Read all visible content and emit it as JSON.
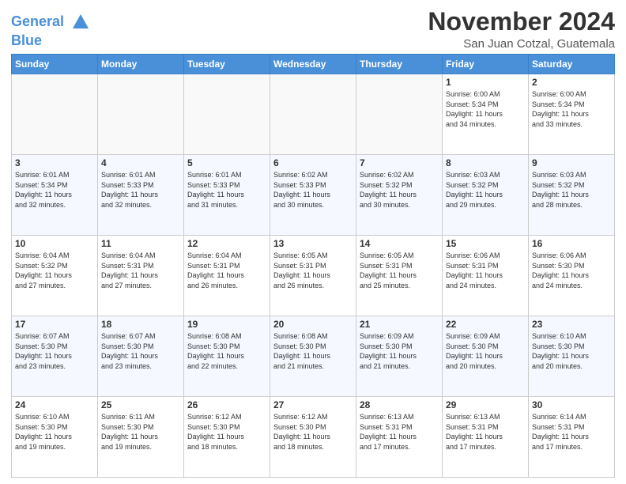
{
  "logo": {
    "line1": "General",
    "line2": "Blue"
  },
  "title": "November 2024",
  "location": "San Juan Cotzal, Guatemala",
  "days_header": [
    "Sunday",
    "Monday",
    "Tuesday",
    "Wednesday",
    "Thursday",
    "Friday",
    "Saturday"
  ],
  "weeks": [
    [
      {
        "day": "",
        "info": ""
      },
      {
        "day": "",
        "info": ""
      },
      {
        "day": "",
        "info": ""
      },
      {
        "day": "",
        "info": ""
      },
      {
        "day": "",
        "info": ""
      },
      {
        "day": "1",
        "info": "Sunrise: 6:00 AM\nSunset: 5:34 PM\nDaylight: 11 hours\nand 34 minutes."
      },
      {
        "day": "2",
        "info": "Sunrise: 6:00 AM\nSunset: 5:34 PM\nDaylight: 11 hours\nand 33 minutes."
      }
    ],
    [
      {
        "day": "3",
        "info": "Sunrise: 6:01 AM\nSunset: 5:34 PM\nDaylight: 11 hours\nand 32 minutes."
      },
      {
        "day": "4",
        "info": "Sunrise: 6:01 AM\nSunset: 5:33 PM\nDaylight: 11 hours\nand 32 minutes."
      },
      {
        "day": "5",
        "info": "Sunrise: 6:01 AM\nSunset: 5:33 PM\nDaylight: 11 hours\nand 31 minutes."
      },
      {
        "day": "6",
        "info": "Sunrise: 6:02 AM\nSunset: 5:33 PM\nDaylight: 11 hours\nand 30 minutes."
      },
      {
        "day": "7",
        "info": "Sunrise: 6:02 AM\nSunset: 5:32 PM\nDaylight: 11 hours\nand 30 minutes."
      },
      {
        "day": "8",
        "info": "Sunrise: 6:03 AM\nSunset: 5:32 PM\nDaylight: 11 hours\nand 29 minutes."
      },
      {
        "day": "9",
        "info": "Sunrise: 6:03 AM\nSunset: 5:32 PM\nDaylight: 11 hours\nand 28 minutes."
      }
    ],
    [
      {
        "day": "10",
        "info": "Sunrise: 6:04 AM\nSunset: 5:32 PM\nDaylight: 11 hours\nand 27 minutes."
      },
      {
        "day": "11",
        "info": "Sunrise: 6:04 AM\nSunset: 5:31 PM\nDaylight: 11 hours\nand 27 minutes."
      },
      {
        "day": "12",
        "info": "Sunrise: 6:04 AM\nSunset: 5:31 PM\nDaylight: 11 hours\nand 26 minutes."
      },
      {
        "day": "13",
        "info": "Sunrise: 6:05 AM\nSunset: 5:31 PM\nDaylight: 11 hours\nand 26 minutes."
      },
      {
        "day": "14",
        "info": "Sunrise: 6:05 AM\nSunset: 5:31 PM\nDaylight: 11 hours\nand 25 minutes."
      },
      {
        "day": "15",
        "info": "Sunrise: 6:06 AM\nSunset: 5:31 PM\nDaylight: 11 hours\nand 24 minutes."
      },
      {
        "day": "16",
        "info": "Sunrise: 6:06 AM\nSunset: 5:30 PM\nDaylight: 11 hours\nand 24 minutes."
      }
    ],
    [
      {
        "day": "17",
        "info": "Sunrise: 6:07 AM\nSunset: 5:30 PM\nDaylight: 11 hours\nand 23 minutes."
      },
      {
        "day": "18",
        "info": "Sunrise: 6:07 AM\nSunset: 5:30 PM\nDaylight: 11 hours\nand 23 minutes."
      },
      {
        "day": "19",
        "info": "Sunrise: 6:08 AM\nSunset: 5:30 PM\nDaylight: 11 hours\nand 22 minutes."
      },
      {
        "day": "20",
        "info": "Sunrise: 6:08 AM\nSunset: 5:30 PM\nDaylight: 11 hours\nand 21 minutes."
      },
      {
        "day": "21",
        "info": "Sunrise: 6:09 AM\nSunset: 5:30 PM\nDaylight: 11 hours\nand 21 minutes."
      },
      {
        "day": "22",
        "info": "Sunrise: 6:09 AM\nSunset: 5:30 PM\nDaylight: 11 hours\nand 20 minutes."
      },
      {
        "day": "23",
        "info": "Sunrise: 6:10 AM\nSunset: 5:30 PM\nDaylight: 11 hours\nand 20 minutes."
      }
    ],
    [
      {
        "day": "24",
        "info": "Sunrise: 6:10 AM\nSunset: 5:30 PM\nDaylight: 11 hours\nand 19 minutes."
      },
      {
        "day": "25",
        "info": "Sunrise: 6:11 AM\nSunset: 5:30 PM\nDaylight: 11 hours\nand 19 minutes."
      },
      {
        "day": "26",
        "info": "Sunrise: 6:12 AM\nSunset: 5:30 PM\nDaylight: 11 hours\nand 18 minutes."
      },
      {
        "day": "27",
        "info": "Sunrise: 6:12 AM\nSunset: 5:30 PM\nDaylight: 11 hours\nand 18 minutes."
      },
      {
        "day": "28",
        "info": "Sunrise: 6:13 AM\nSunset: 5:31 PM\nDaylight: 11 hours\nand 17 minutes."
      },
      {
        "day": "29",
        "info": "Sunrise: 6:13 AM\nSunset: 5:31 PM\nDaylight: 11 hours\nand 17 minutes."
      },
      {
        "day": "30",
        "info": "Sunrise: 6:14 AM\nSunset: 5:31 PM\nDaylight: 11 hours\nand 17 minutes."
      }
    ]
  ]
}
